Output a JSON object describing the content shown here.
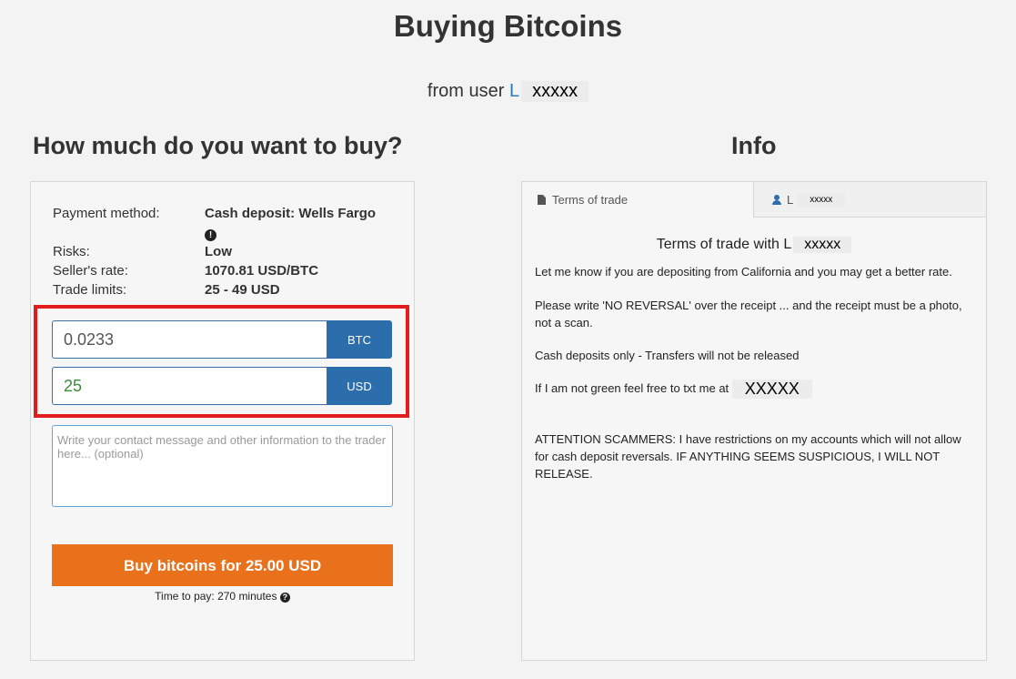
{
  "page": {
    "title": "Buying Bitcoins",
    "from_prefix": "from user",
    "username_initial": "L",
    "username_redacted": "xxxxx"
  },
  "buy_section": {
    "title": "How much do you want to buy?",
    "rows": [
      {
        "label": "Payment method:",
        "value": "Cash deposit: Wells Fargo"
      },
      {
        "label": "Risks:",
        "value": "Low"
      },
      {
        "label": "Seller's rate:",
        "value": "1070.81 USD/BTC"
      },
      {
        "label": "Trade limits:",
        "value": "25 - 49 USD"
      }
    ],
    "btc_amount": "0.0233",
    "btc_label": "BTC",
    "usd_amount": "25",
    "usd_label": "USD",
    "message_placeholder": "Write your contact message and other information to the trader here... (optional)",
    "buy_button_label": "Buy bitcoins for 25.00 USD",
    "time_to_pay": "Time to pay: 270 minutes"
  },
  "info_section": {
    "title": "Info",
    "tabs": [
      {
        "label": "Terms of trade",
        "icon": "document-icon"
      },
      {
        "label": "L",
        "redacted": "xxxxx",
        "icon": "user-icon"
      }
    ],
    "terms_heading_prefix": "Terms of trade with L",
    "terms_heading_redacted": "xxxxx",
    "paragraphs": [
      "Let me know if you are depositing from California and you may get a better rate.",
      "Please write 'NO REVERSAL' over the receipt ... and the receipt must be a photo, not a scan.",
      "Cash deposits only - Transfers will not be released",
      "ATTENTION SCAMMERS: I have restrictions on my accounts which will not allow for cash deposit reversals. IF ANYTHING SEEMS SUSPICIOUS, I WILL NOT RELEASE."
    ],
    "txt_prefix": "If I am not green feel free to txt me at",
    "txt_redacted": "XXXXX"
  },
  "colors": {
    "accent_blue": "#2c6eab",
    "buy_orange": "#ea711c",
    "highlight_red": "#e21b1b"
  }
}
